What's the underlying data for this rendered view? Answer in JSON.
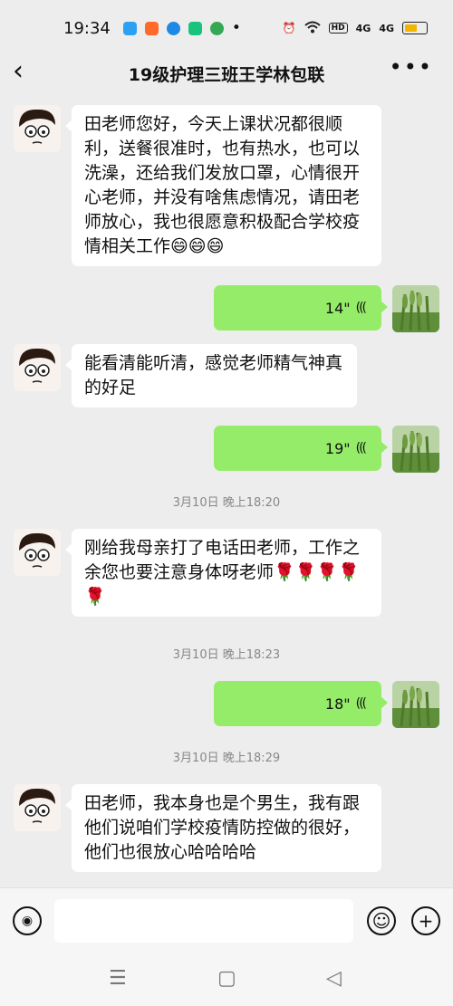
{
  "status": {
    "time": "19:34",
    "dot": "•",
    "hd": "HD",
    "sig1": "4G",
    "sig2": "4G",
    "app_icons": [
      {
        "name": "paper-plane-app-icon",
        "color": "#2ea0f2"
      },
      {
        "name": "orange-app-icon",
        "color": "#ff6a2b"
      },
      {
        "name": "blue-circle-app-icon",
        "color": "#1e88e5"
      },
      {
        "name": "green-app-icon",
        "color": "#19c37d"
      },
      {
        "name": "play-app-icon",
        "color": "#34a853"
      }
    ]
  },
  "header": {
    "title": "19级护理三班王学林包联",
    "back_glyph": "‹",
    "more_glyph": "•••"
  },
  "messages": [
    {
      "type": "in",
      "text": "田老师您好，今天上课状况都很顺利，送餐很准时，也有热水，也可以洗澡，还给我们发放口罩，心情很开心老师，并没有啥焦虑情况，请田老师放心，我也很愿意积极配合学校疫情相关工作😄😄😄"
    },
    {
      "type": "out_voice",
      "duration": "14\""
    },
    {
      "type": "in",
      "text": "能看清能听清，感觉老师精气神真的好足"
    },
    {
      "type": "out_voice",
      "duration": "19\""
    },
    {
      "type": "time",
      "text": "3月10日 晚上18:20"
    },
    {
      "type": "in",
      "text": "刚给我母亲打了电话田老师，工作之余您也要注意身体呀老师🌹🌹🌹🌹🌹"
    },
    {
      "type": "time",
      "text": "3月10日 晚上18:23"
    },
    {
      "type": "out_voice",
      "duration": "18\""
    },
    {
      "type": "time",
      "text": "3月10日 晚上18:29"
    },
    {
      "type": "in",
      "text": "田老师，我本身也是个男生，我有跟他们说咱们学校疫情防控做的很好，他们也很放心哈哈哈哈"
    }
  ],
  "input": {
    "voice_glyph": "◉",
    "emoji_glyph": "☺",
    "plus_glyph": "+",
    "text_value": ""
  },
  "nav": {
    "menu": "☰",
    "home": "▢",
    "back": "◁"
  },
  "colors": {
    "outgoing": "#95ec69",
    "incoming": "#ffffff",
    "background": "#ededed"
  }
}
